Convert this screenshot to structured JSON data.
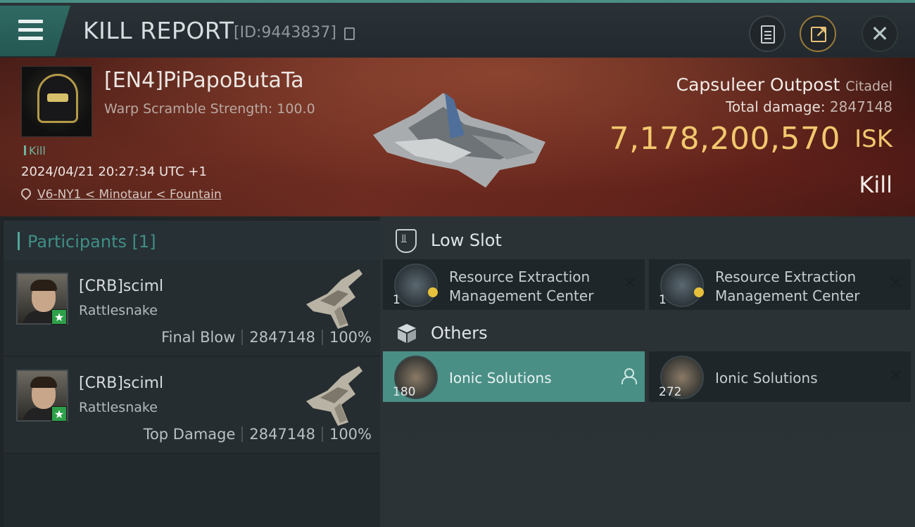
{
  "header": {
    "title": "KILL REPORT",
    "report_id": "[ID:9443837]"
  },
  "victim": {
    "name": "[EN4]PiPapoButaTa",
    "subtitle": "Warp Scramble Strength: 100.0",
    "tag": "Kill",
    "datetime": "2024/04/21 20:27:34 UTC +1",
    "location": "V6-NY1 < Minotaur < Fountain"
  },
  "target": {
    "name": "Capsuleer Outpost",
    "class": "Citadel",
    "total_damage_label": "Total damage:",
    "total_damage_value": "2847148",
    "isk_value": "7,178,200,570",
    "isk_unit": "ISK",
    "status": "Kill"
  },
  "participants": {
    "title": "Participants [1]",
    "rows": [
      {
        "name": "[CRB]sciml",
        "ship": "Rattlesnake",
        "role": "Final Blow",
        "damage": "2847148",
        "percent": "100%"
      },
      {
        "name": "[CRB]sciml",
        "ship": "Rattlesnake",
        "role": "Top Damage",
        "damage": "2847148",
        "percent": "100%"
      }
    ]
  },
  "low_slot": {
    "title": "Low Slot",
    "items": [
      {
        "qty": "1",
        "name_line1": "Resource Extraction",
        "name_line2": "Management Center"
      },
      {
        "qty": "1",
        "name_line1": "Resource Extraction",
        "name_line2": "Management Center"
      }
    ]
  },
  "others": {
    "title": "Others",
    "items": [
      {
        "qty": "180",
        "name": "Ionic Solutions"
      },
      {
        "qty": "272",
        "name": "Ionic Solutions"
      }
    ]
  },
  "icons": {
    "menu": "hamburger-icon",
    "copy": "copy-icon",
    "clipboard": "clipboard-icon",
    "share": "share-icon",
    "close": "close-icon",
    "location": "location-pin-icon",
    "low_slot": "shield-icon",
    "others": "box-icon",
    "person": "person-icon",
    "remove": "x-icon",
    "badge": "star-badge-icon"
  },
  "colors": {
    "accent": "#4a8f86",
    "isk": "#f2c86e",
    "badge": "#2ea04a"
  }
}
